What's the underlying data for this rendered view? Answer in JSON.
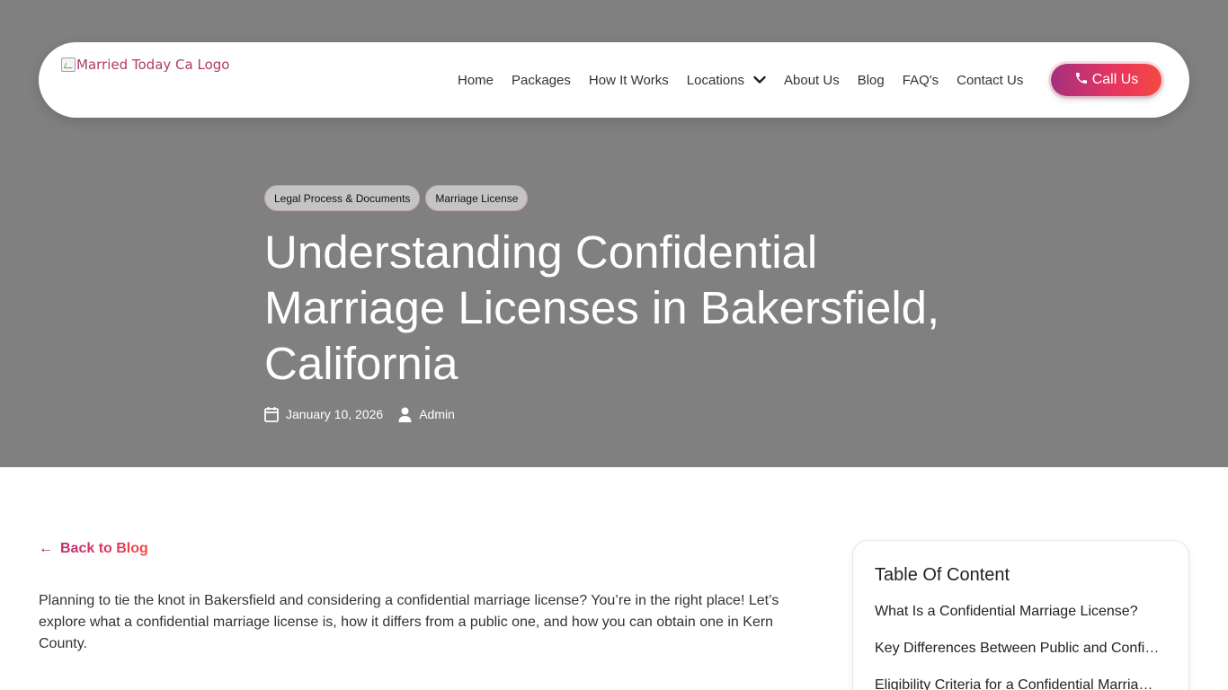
{
  "header": {
    "logo_alt": "Married Today Ca Logo",
    "nav": [
      {
        "label": "Home"
      },
      {
        "label": "Packages"
      },
      {
        "label": "How It Works"
      },
      {
        "label": "Locations"
      },
      {
        "label": "About Us"
      },
      {
        "label": "Blog"
      },
      {
        "label": "FAQ's"
      },
      {
        "label": "Contact Us"
      }
    ],
    "call_label": "Call Us"
  },
  "post": {
    "tags": [
      {
        "label": "Legal Process & Documents"
      },
      {
        "label": "Marriage License"
      }
    ],
    "title": "Understanding Confidential Marriage Licenses in Bakersfield, California",
    "date": "January 10, 2026",
    "author": "Admin"
  },
  "content": {
    "back_label": "Back to Blog",
    "intro": "Planning to tie the knot in Bakersfield and considering a confidential marriage license? You’re in the right place! Let’s explore what a confidential marriage license is, how it differs from a public one, and how you can obtain one in Kern County."
  },
  "toc": {
    "title": "Table Of Content",
    "items": [
      {
        "label": "What Is a Confidential Marriage License?"
      },
      {
        "label": "Key Differences Between Public and Confidential Marriage Licenses"
      },
      {
        "label": "Eligibility Criteria for a Confidential Marriage License"
      }
    ]
  },
  "colors": {
    "hero_bg": "#808080",
    "accent_start": "#a4307e",
    "accent_end": "#f24a40"
  },
  "icons": {
    "calendar": "calendar-icon",
    "user": "user-icon",
    "phone": "phone-icon",
    "back": "arrow-left-icon",
    "dropdown": "chevron-down-icon"
  }
}
